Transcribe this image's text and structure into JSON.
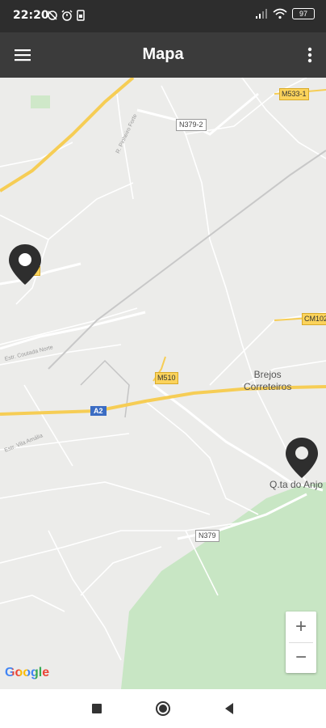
{
  "status_bar": {
    "time": "22:20",
    "battery": "97"
  },
  "app_bar": {
    "title": "Mapa"
  },
  "map": {
    "road_labels": {
      "m533": "M533-1",
      "n379_2": "N379-2",
      "cm102": "CM102",
      "m510": "M510",
      "a2": "A2",
      "n379": "N379"
    },
    "street_labels": {
      "pinheiro_forte": "R. Pinheiro Forte",
      "coutada_norte": "Estr. Coutada Norte",
      "vila_amalia": "Estr. Vila Amália"
    },
    "places": {
      "brejos_line1": "Brejos",
      "brejos_line2": "Correteiros",
      "quinta": "Q.ta do Anjo"
    },
    "zoom": {
      "in": "+",
      "out": "−"
    },
    "attribution": "Google"
  },
  "colors": {
    "status_bar": "#2d2d2d",
    "app_bar": "#3b3b3b",
    "map_bg": "#ececea",
    "park": "#c8e6c4",
    "highway": "#f6cd55",
    "pin": "#2e2e2e"
  }
}
